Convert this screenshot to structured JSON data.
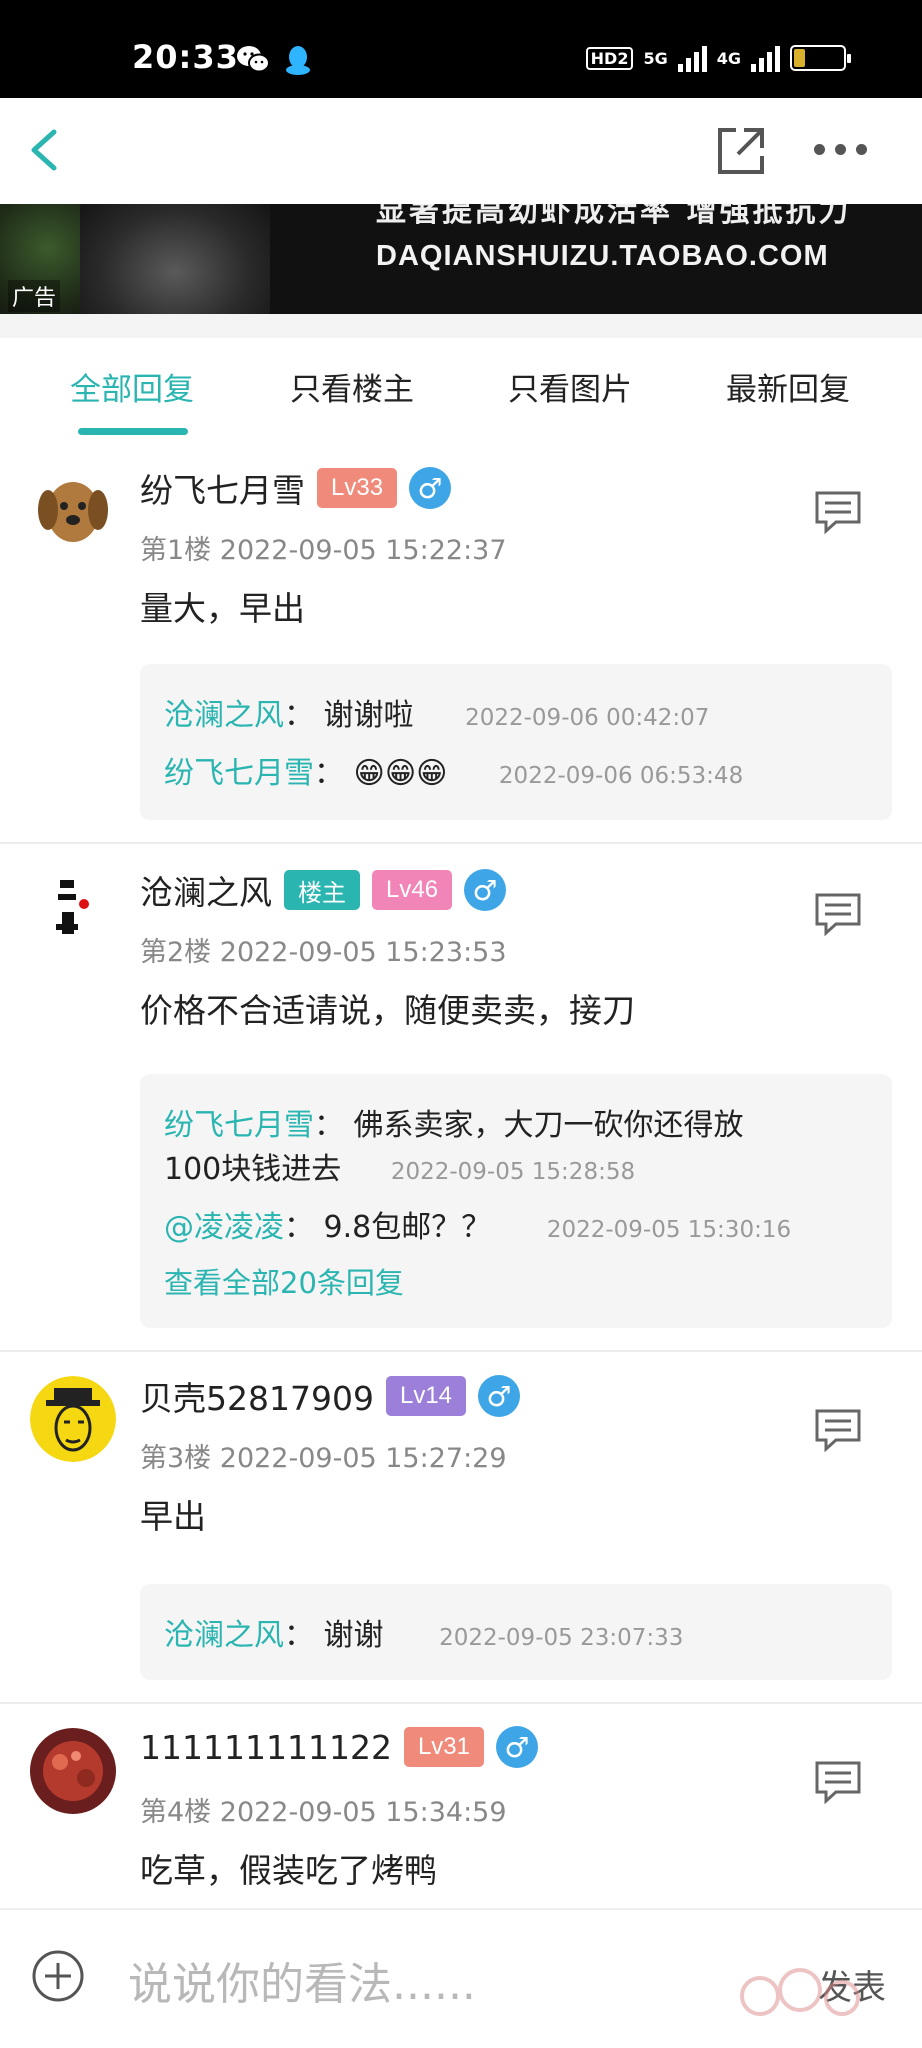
{
  "status_bar": {
    "time": "20:33",
    "app_icons": [
      "wechat-icon",
      "qq-icon"
    ],
    "hd_label": "HD2",
    "net1": "5G",
    "net2": "4G",
    "battery": "22",
    "battery_level_percent": 22
  },
  "navbar": {
    "back_icon": "chevron-left-icon",
    "share_icon": "share-icon",
    "more_icon": "more-icon"
  },
  "ad": {
    "slogan": "显著提高幼虾成活率 增强抵抗力",
    "url": "DAQIANSHUIZU.TAOBAO.COM",
    "tag": "广告"
  },
  "tabs": [
    {
      "label": "全部回复",
      "active": true
    },
    {
      "label": "只看楼主",
      "active": false
    },
    {
      "label": "只看图片",
      "active": false
    },
    {
      "label": "最新回复",
      "active": false
    }
  ],
  "posts": [
    {
      "username": "纷飞七月雪",
      "badges": [
        {
          "label": "Lv33",
          "color": "#f08a7a"
        }
      ],
      "gender": "♂",
      "floor": "第1楼 2022-09-05 15:22:37",
      "content": "量大，早出",
      "replies": [
        {
          "name": "沧澜之风",
          "sep": "：",
          "text": "谢谢啦",
          "time": "2022-09-06 00:42:07"
        },
        {
          "name": "纷飞七月雪",
          "sep": "：",
          "text": "😁😁😁",
          "time": "2022-09-06 06:53:48"
        }
      ]
    },
    {
      "username": "沧澜之风",
      "badges": [
        {
          "label": "楼主",
          "color": "#2ab5b0"
        },
        {
          "label": "Lv46",
          "color": "#f285b8"
        }
      ],
      "gender": "♂",
      "floor": "第2楼 2022-09-05 15:23:53",
      "content": "价格不合适请说，随便卖卖，接刀",
      "replies": [
        {
          "name": "纷飞七月雪",
          "sep": "：",
          "text": "佛系卖家，大刀一砍你还得放",
          "text2": "100块钱进去",
          "time": "2022-09-05 15:28:58"
        },
        {
          "name": "@凌凌凌",
          "sep": "：",
          "text": "9.8包邮？？",
          "time": "2022-09-05 15:30:16"
        }
      ],
      "view_all": "查看全部20条回复"
    },
    {
      "username": "贝壳52817909",
      "badges": [
        {
          "label": "Lv14",
          "color": "#9b7fd8"
        }
      ],
      "gender": "♂",
      "floor": "第3楼 2022-09-05 15:27:29",
      "content": "早出",
      "replies": [
        {
          "name": "沧澜之风",
          "sep": "：",
          "text": "谢谢",
          "time": "2022-09-05 23:07:33"
        }
      ]
    },
    {
      "username": "111111111122",
      "badges": [
        {
          "label": "Lv31",
          "color": "#f08a7a"
        }
      ],
      "gender": "♂",
      "floor": "第4楼 2022-09-05 15:34:59",
      "content": "吃草，假装吃了烤鸭",
      "replies": []
    }
  ],
  "bottom_bar": {
    "add_icon": "plus-circle-icon",
    "placeholder": "说说你的看法......",
    "send_label": "发表"
  },
  "colors": {
    "accent": "#2ab5b0",
    "gender": "#3ea6e6"
  }
}
